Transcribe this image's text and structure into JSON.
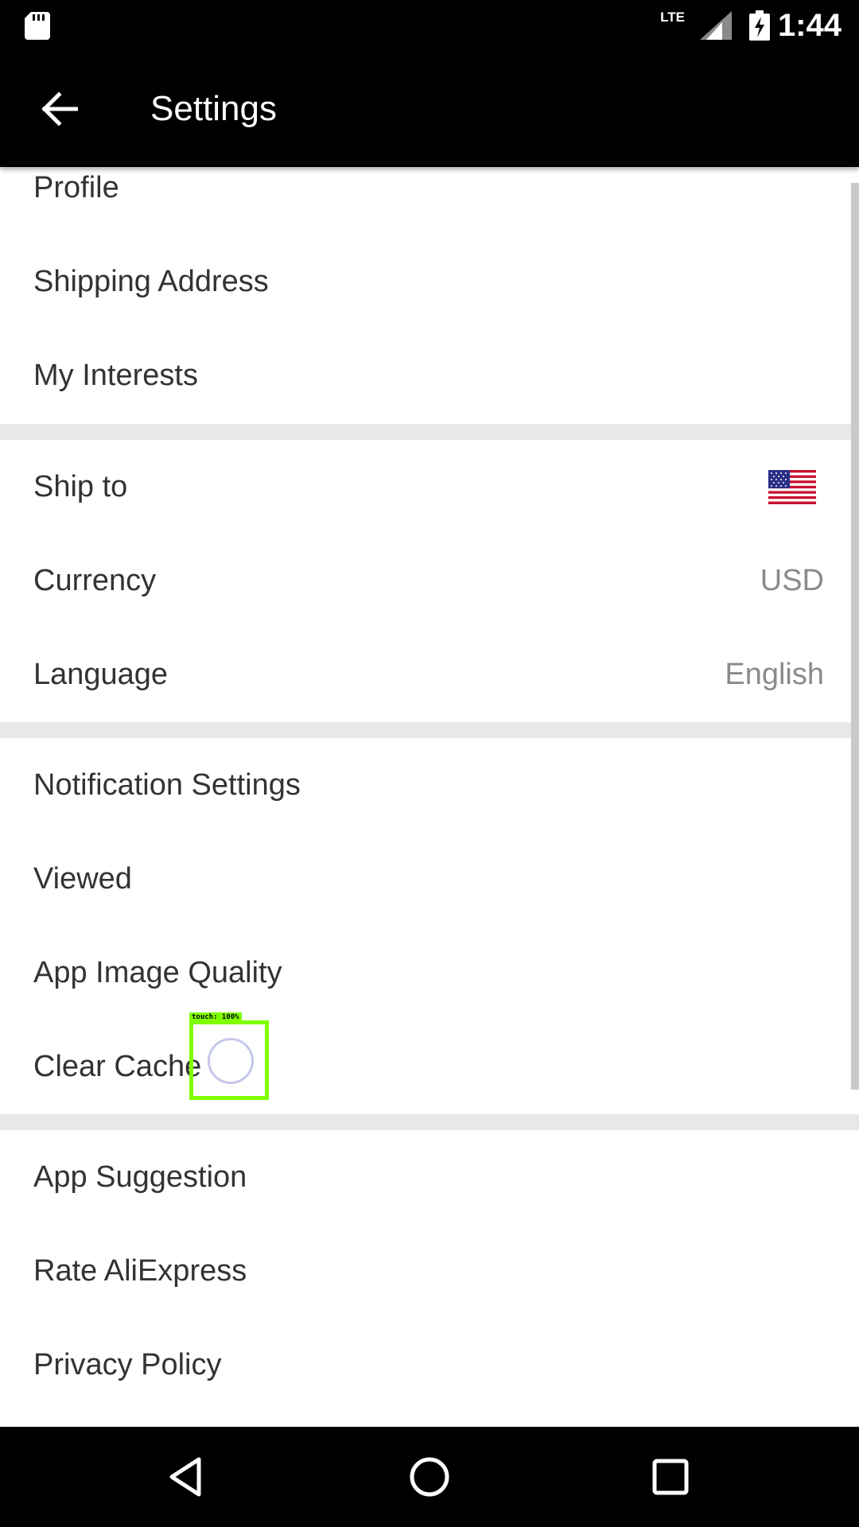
{
  "status_bar": {
    "network": "LTE",
    "time": "1:44",
    "icons": [
      "sd-card-icon",
      "signal-icon",
      "battery-charging-icon"
    ]
  },
  "toolbar": {
    "title": "Settings",
    "back_icon": "arrow-left-icon"
  },
  "sections": [
    {
      "items": [
        {
          "label": "Profile"
        },
        {
          "label": "Shipping Address"
        },
        {
          "label": "My Interests"
        }
      ]
    },
    {
      "items": [
        {
          "label": "Ship to",
          "value_icon": "us-flag-icon"
        },
        {
          "label": "Currency",
          "value": "USD"
        },
        {
          "label": "Language",
          "value": "English"
        }
      ]
    },
    {
      "items": [
        {
          "label": "Notification Settings"
        },
        {
          "label": "Viewed"
        },
        {
          "label": "App Image Quality"
        },
        {
          "label": "Clear Cache"
        }
      ]
    },
    {
      "items": [
        {
          "label": "App Suggestion"
        },
        {
          "label": "Rate AliExpress"
        },
        {
          "label": "Privacy Policy"
        }
      ]
    }
  ],
  "touch_indicator": {
    "label": "touch: 100%"
  },
  "nav_bar": {
    "icons": [
      "back-triangle-icon",
      "home-circle-icon",
      "recents-square-icon"
    ]
  },
  "colors": {
    "toolbar_bg": "#000000",
    "divider": "#e8e8e8",
    "label_text": "#333333",
    "value_text": "#8a8a8a",
    "touch_highlight": "#80ff00"
  }
}
